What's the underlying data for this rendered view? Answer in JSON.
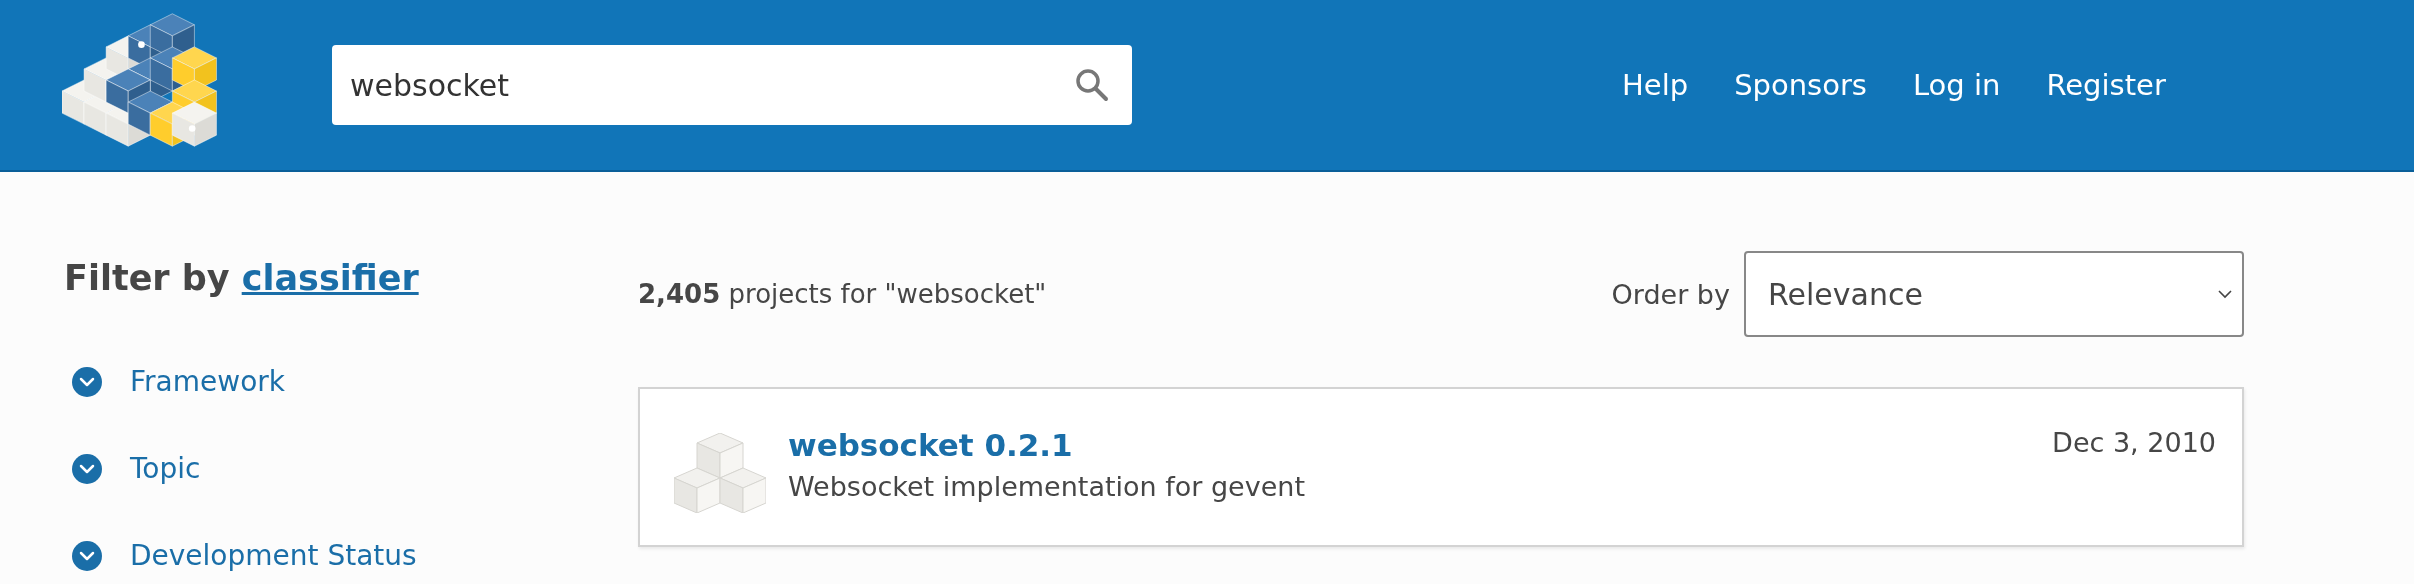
{
  "header": {
    "search": {
      "value": "websocket"
    },
    "nav": [
      "Help",
      "Sponsors",
      "Log in",
      "Register"
    ]
  },
  "sidebar": {
    "heading": "Filter by",
    "heading_link": "classifier",
    "filters": [
      {
        "label": "Framework"
      },
      {
        "label": "Topic"
      },
      {
        "label": "Development Status"
      }
    ]
  },
  "results": {
    "summary": "**2,405** projects for \"websocket\"",
    "order_label": "Order by",
    "order_value": "Relevance",
    "items": [
      {
        "name": "websocket 0.2.1",
        "description": "Websocket implementation for gevent",
        "date": "Dec 3, 2010"
      }
    ]
  }
}
